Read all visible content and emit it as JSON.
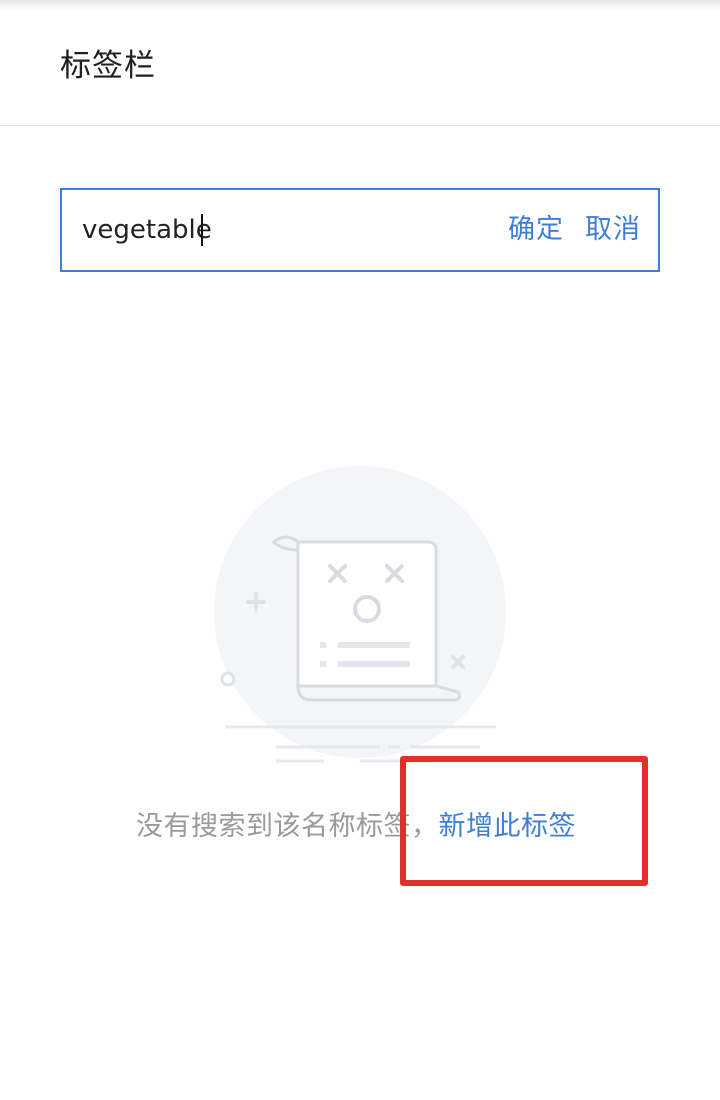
{
  "header": {
    "title": "标签栏"
  },
  "search": {
    "value": "vegetable",
    "confirm_label": "确定",
    "cancel_label": "取消"
  },
  "empty_state": {
    "illustration_icon": "empty-document-icon",
    "message": "没有搜索到该名称标签，",
    "add_link_label": "新增此标签"
  },
  "colors": {
    "accent": "#3e7fd6",
    "muted_text": "#9a9a9a",
    "highlight": "#e0302a"
  }
}
